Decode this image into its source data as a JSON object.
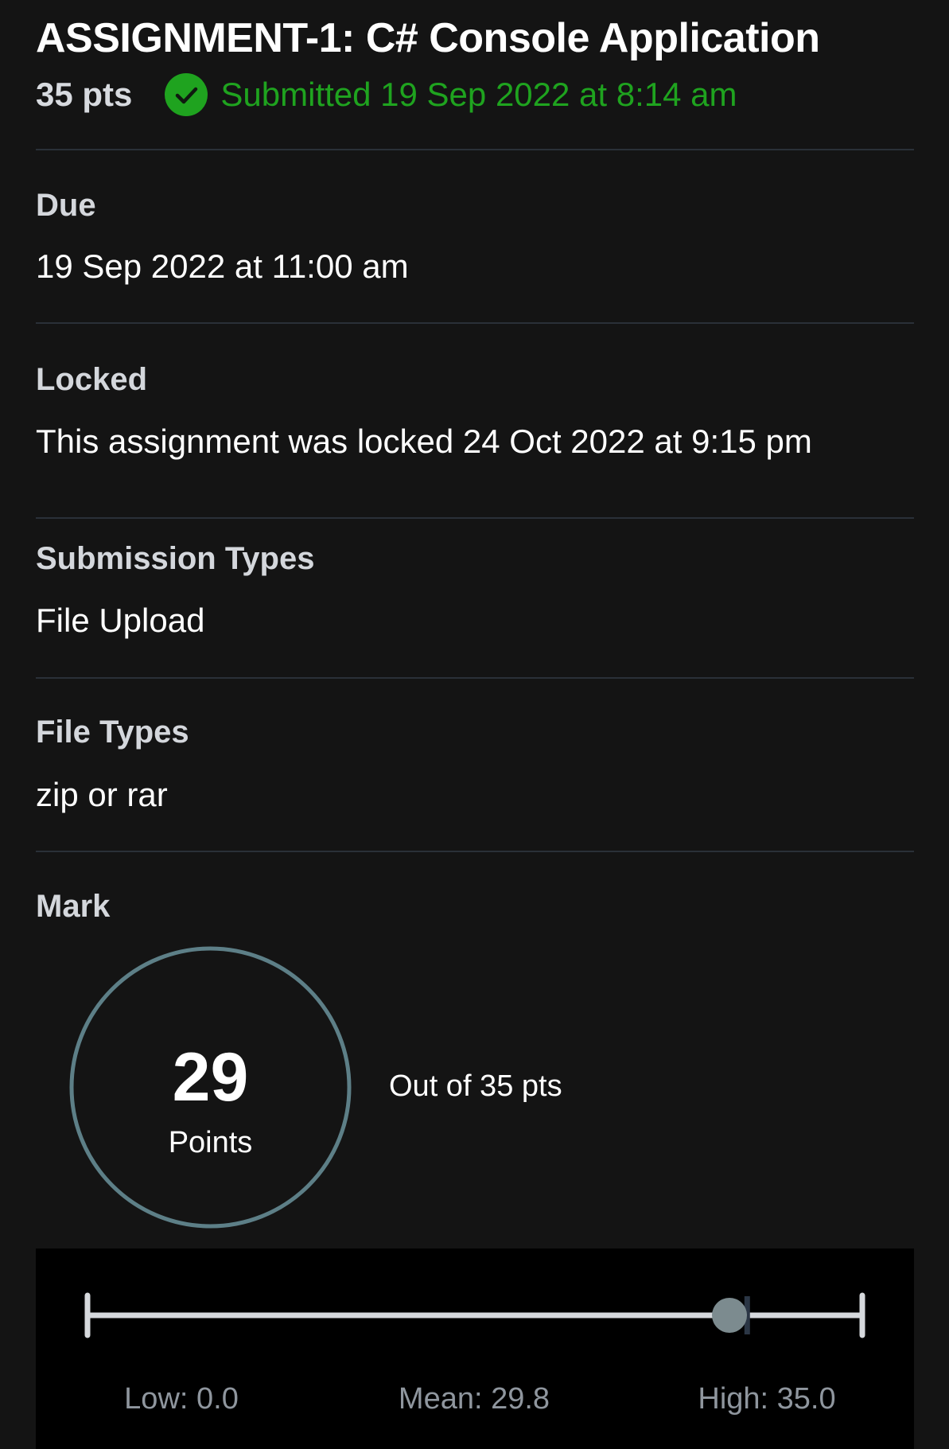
{
  "assignment": {
    "title": "ASSIGNMENT-1: C# Console Application",
    "points": "35 pts",
    "status_icon": "check-circle-icon",
    "submitted_text": "Submitted 19 Sep 2022 at 8:14 am",
    "status_color": "#1fa31f"
  },
  "details": {
    "due": {
      "label": "Due",
      "value": "19 Sep 2022 at 11:00 am"
    },
    "locked": {
      "label": "Locked",
      "value": "This assignment was locked 24 Oct 2022 at 9:15 pm"
    },
    "submission_types": {
      "label": "Submission Types",
      "value": "File Upload"
    },
    "file_types": {
      "label": "File Types",
      "value": "zip or rar"
    }
  },
  "mark": {
    "label": "Mark",
    "score": "29",
    "score_unit": "Points",
    "out_of": "Out of 35 pts",
    "ring_color": "#5d7f87"
  },
  "statistics": {
    "min": 0.0,
    "max": 35.0,
    "mean": 29.8,
    "score": 29,
    "low_label": "Low: 0.0",
    "mean_label": "Mean: 29.8",
    "high_label": "High: 35.0"
  }
}
